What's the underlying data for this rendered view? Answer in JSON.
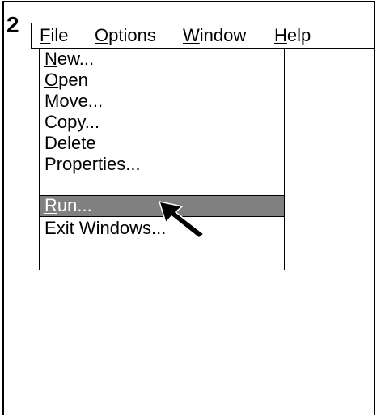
{
  "step_number": "2",
  "menubar": {
    "items": [
      {
        "id": "file",
        "mnemonic": "F",
        "rest": "ile"
      },
      {
        "id": "options",
        "mnemonic": "O",
        "rest": "ptions"
      },
      {
        "id": "window",
        "mnemonic": "W",
        "rest": "indow"
      },
      {
        "id": "help",
        "mnemonic": "H",
        "rest": "elp"
      }
    ]
  },
  "file_menu": {
    "items": [
      {
        "mnemonic": "N",
        "rest": "ew...",
        "selected": false
      },
      {
        "mnemonic": "O",
        "rest": "pen",
        "selected": false
      },
      {
        "mnemonic": "M",
        "rest": "ove...",
        "selected": false
      },
      {
        "mnemonic": "C",
        "rest": "opy...",
        "selected": false
      },
      {
        "mnemonic": "D",
        "rest": "elete",
        "selected": false
      },
      {
        "mnemonic": "P",
        "rest": "roperties...",
        "selected": false
      },
      {
        "mnemonic": "R",
        "rest": "un...",
        "selected": true
      },
      {
        "mnemonic": "E",
        "rest": "xit Windows...",
        "selected": false
      }
    ]
  },
  "pointer": {
    "icon": "arrow-cursor-icon",
    "target_item": "Run..."
  },
  "colors": {
    "highlight": "#808080",
    "highlight_text": "#ffffff",
    "border": "#000000"
  }
}
